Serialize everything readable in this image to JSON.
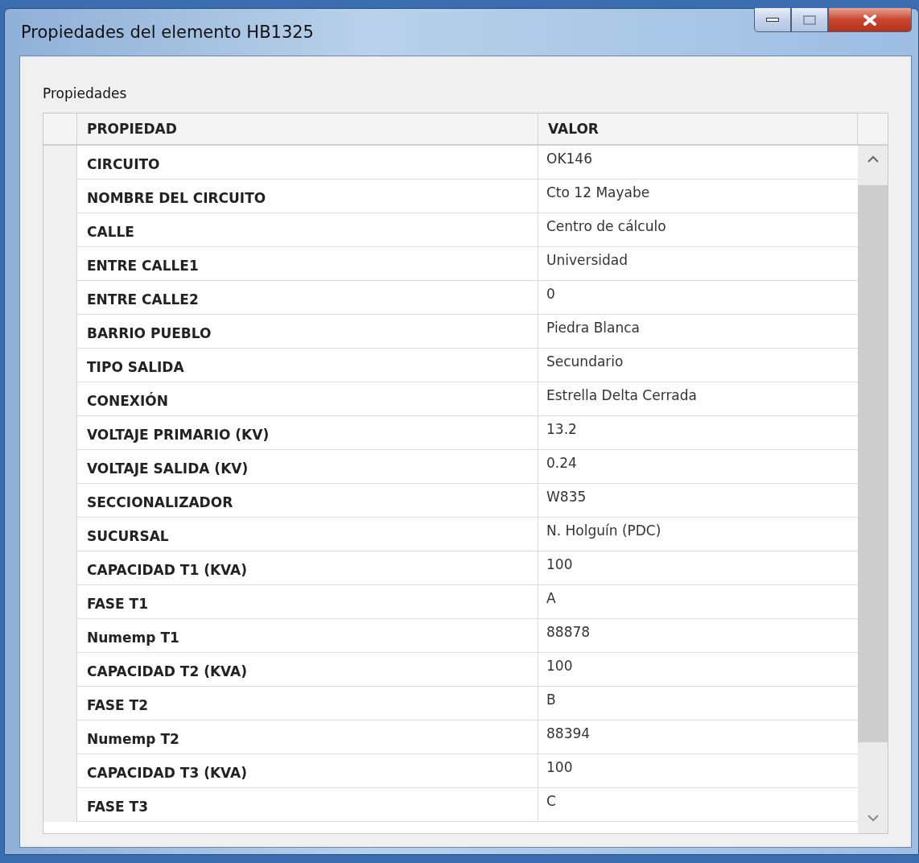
{
  "window": {
    "title": "Propiedades del elemento HB1325"
  },
  "group": {
    "label": "Propiedades"
  },
  "table": {
    "columns": [
      "PROPIEDAD",
      "VALOR"
    ],
    "rows": [
      {
        "property": "CIRCUITO",
        "value": "OK146"
      },
      {
        "property": "NOMBRE DEL CIRCUITO",
        "value": "Cto 12 Mayabe"
      },
      {
        "property": "CALLE",
        "value": "Centro de cálculo"
      },
      {
        "property": "ENTRE CALLE1",
        "value": "Universidad"
      },
      {
        "property": "ENTRE CALLE2",
        "value": "0"
      },
      {
        "property": "BARRIO PUEBLO",
        "value": "Piedra Blanca"
      },
      {
        "property": "TIPO SALIDA",
        "value": "Secundario"
      },
      {
        "property": "CONEXIÓN",
        "value": "Estrella Delta Cerrada"
      },
      {
        "property": "VOLTAJE PRIMARIO (KV)",
        "value": "13.2"
      },
      {
        "property": "VOLTAJE SALIDA (KV)",
        "value": "0.24"
      },
      {
        "property": "SECCIONALIZADOR",
        "value": "W835"
      },
      {
        "property": "SUCURSAL",
        "value": "N. Holguín (PDC)"
      },
      {
        "property": "CAPACIDAD T1 (KVA)",
        "value": "100"
      },
      {
        "property": "FASE T1",
        "value": "A"
      },
      {
        "property": "Numemp T1",
        "value": "88878"
      },
      {
        "property": "CAPACIDAD T2 (KVA)",
        "value": "100"
      },
      {
        "property": "FASE T2",
        "value": "B"
      },
      {
        "property": "Numemp T2",
        "value": "88394"
      },
      {
        "property": "CAPACIDAD T3 (KVA)",
        "value": "100"
      },
      {
        "property": "FASE T3",
        "value": "C"
      }
    ]
  }
}
